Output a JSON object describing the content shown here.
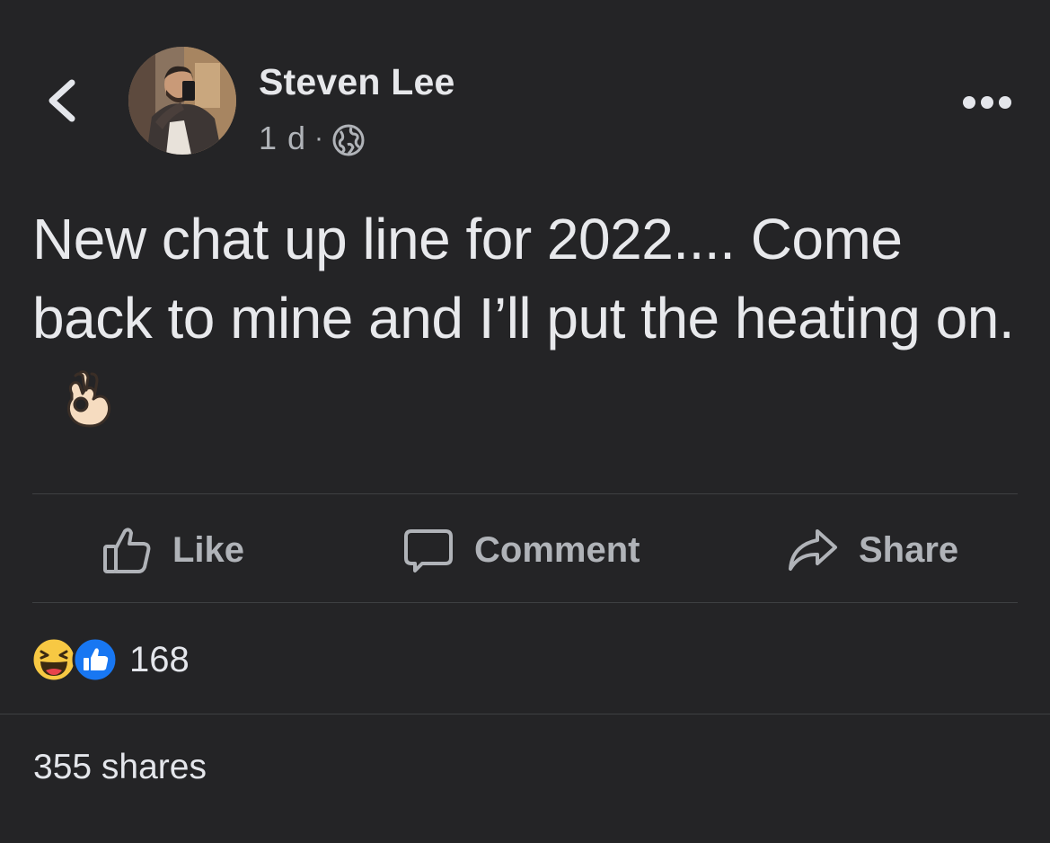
{
  "post": {
    "author": "Steven Lee",
    "time": "1 d",
    "separator": "·",
    "audience_icon": "globe-icon",
    "text": "New chat up line for 2022.... Come back to mine and I’ll put the heating on.",
    "emoji_icon": "ok-hand-emoji"
  },
  "actions": {
    "like_label": "Like",
    "comment_label": "Comment",
    "share_label": "Share"
  },
  "reactions": {
    "icons": [
      "haha-reaction-icon",
      "like-reaction-icon"
    ],
    "count": "168"
  },
  "shares": {
    "label": "355 shares"
  },
  "colors": {
    "background": "#242426",
    "primary_text": "#e4e6eb",
    "secondary_text": "#b0b3b8",
    "like_blue": "#1877f2",
    "haha_yellow": "#f7c843",
    "divider": "#3e4042"
  }
}
